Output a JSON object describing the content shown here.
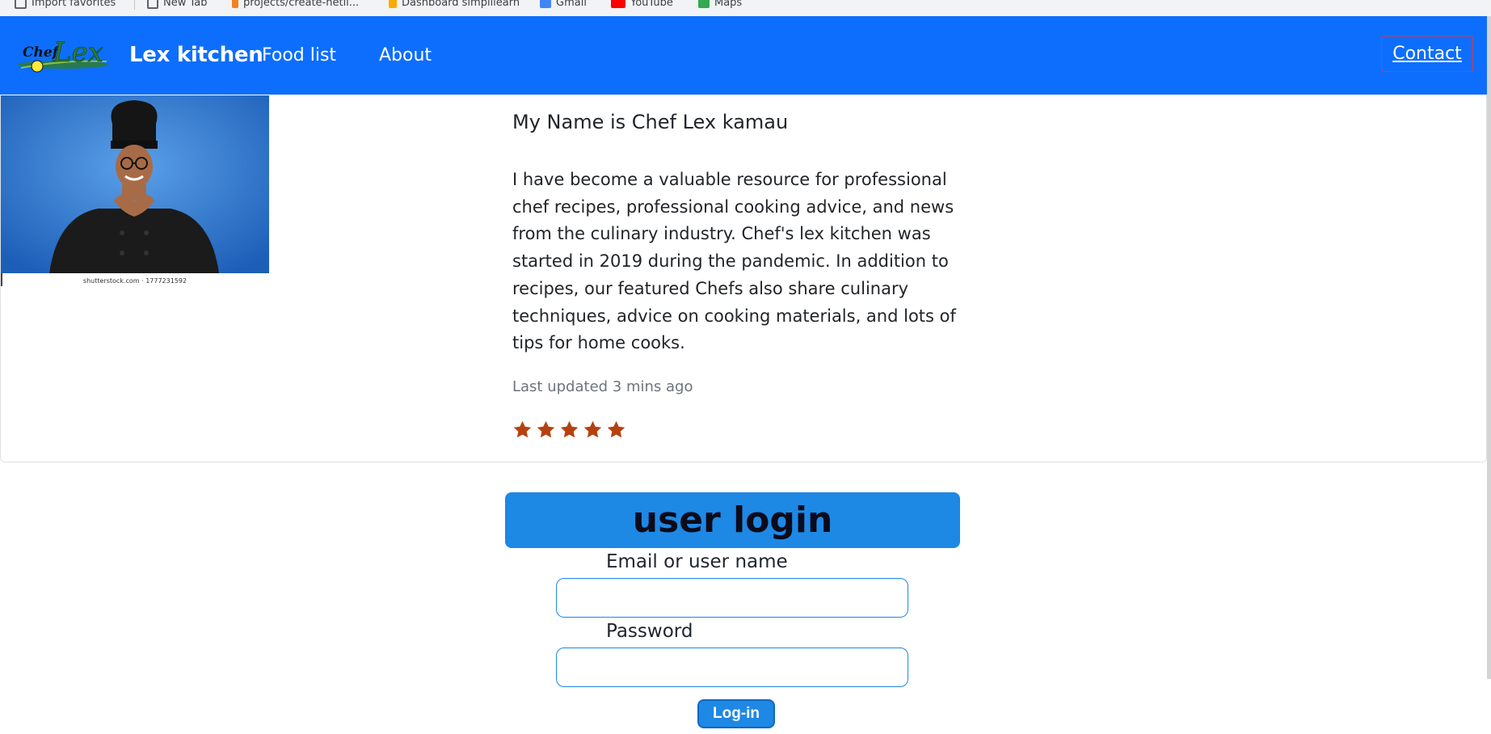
{
  "browser": {
    "bookmarks": [
      {
        "label": "Import favorites",
        "color": "#5f6368"
      },
      {
        "label": "New Tab",
        "color": "#5f6368"
      },
      {
        "label": "projects/create-netli...",
        "color": "#f48120"
      },
      {
        "label": "Dashboard simplilearn",
        "color": "#f9ab00"
      },
      {
        "label": "Gmail",
        "color": "#4285f4"
      },
      {
        "label": "YouTube",
        "color": "#ff0000"
      },
      {
        "label": "Maps",
        "color": "#34a853"
      }
    ]
  },
  "navbar": {
    "logo_text_top": "Chef",
    "logo_text_main": "Lex",
    "brand": "Lex kitchen",
    "links": [
      "Food list",
      "About"
    ],
    "contact": "Contact",
    "bg_color": "#0d6efd"
  },
  "card": {
    "image_caption": "shutterstock.com · 1777231592",
    "title": "My Name is Chef Lex kamau",
    "text": "I have become a valuable resource for professional chef recipes, professional cooking advice, and news from the culinary industry. Chef's lex kitchen was started in 2019 during the pandemic. In addition to recipes, our featured Chefs also share culinary techniques, advice on cooking materials, and lots of tips for home cooks.",
    "updated": "Last updated 3 mins ago",
    "rating": 5,
    "star_color": "#b5410f"
  },
  "login": {
    "title": "user login",
    "email_label": "Email or user name",
    "email_value": "",
    "password_label": "Password",
    "password_value": "",
    "button": "Log-in"
  }
}
